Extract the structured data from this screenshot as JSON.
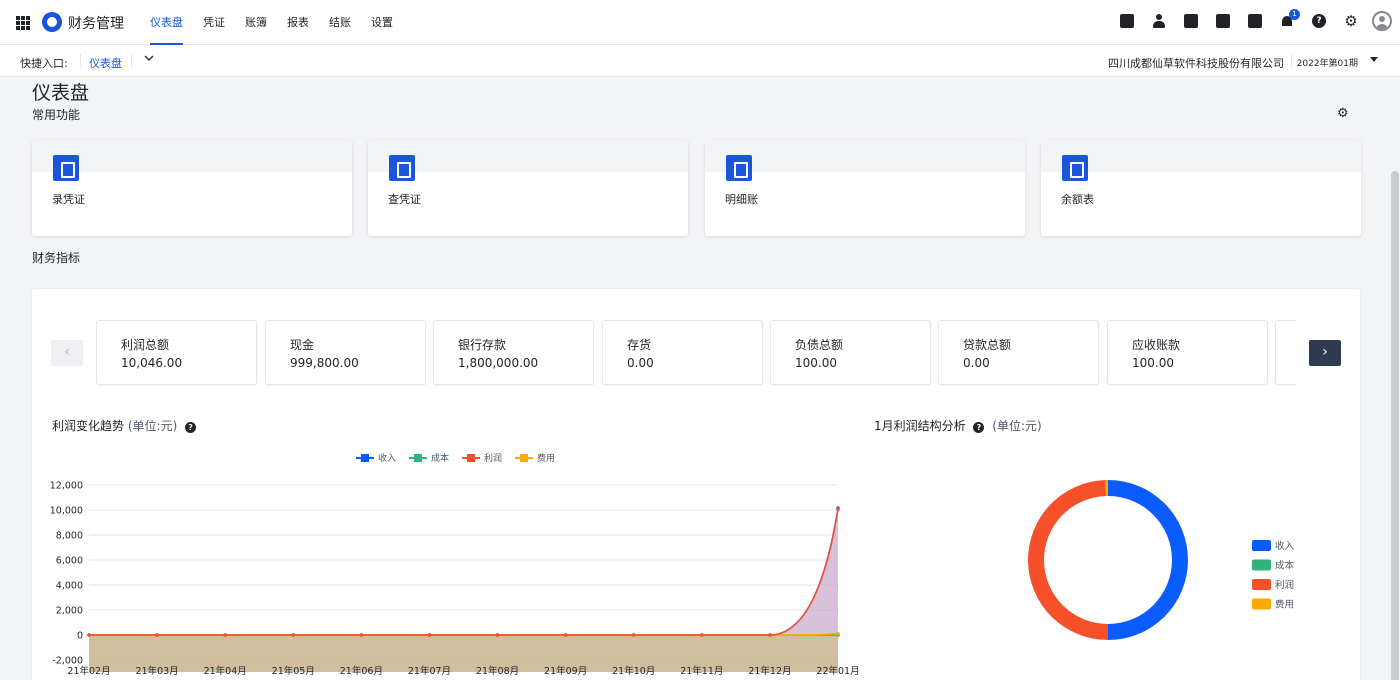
{
  "header": {
    "app_title": "财务管理",
    "nav": [
      "仪表盘",
      "凭证",
      "账簿",
      "报表",
      "结账",
      "设置"
    ],
    "active_nav": 0,
    "notification_count": "1"
  },
  "subbar": {
    "quick_label": "快捷入口:",
    "quick_link": "仪表盘",
    "company": "四川成都仙草软件科技股份有限公司",
    "period": "2022年第01期"
  },
  "page": {
    "title": "仪表盘",
    "common_functions_label": "常用功能",
    "metrics_label": "财务指标"
  },
  "functions": [
    {
      "label": "录凭证",
      "icon": "voucher-entry-icon"
    },
    {
      "label": "查凭证",
      "icon": "voucher-search-icon"
    },
    {
      "label": "明细账",
      "icon": "ledger-icon"
    },
    {
      "label": "余额表",
      "icon": "balance-list-icon"
    }
  ],
  "metrics": [
    {
      "label": "利润总额",
      "value": "10,046.00"
    },
    {
      "label": "现金",
      "value": "999,800.00"
    },
    {
      "label": "银行存款",
      "value": "1,800,000.00"
    },
    {
      "label": "存货",
      "value": "0.00"
    },
    {
      "label": "负债总额",
      "value": "100.00"
    },
    {
      "label": "贷款总额",
      "value": "0.00"
    },
    {
      "label": "应收账款",
      "value": "100.00"
    },
    {
      "label": "",
      "value": ""
    }
  ],
  "trend_chart": {
    "title": "利润变化趋势",
    "unit": "(单位:元)"
  },
  "pie_chart": {
    "title": "1月利润结构分析",
    "unit": "(单位:元)"
  },
  "colors": {
    "accent": "#1a56db",
    "income": "#0a5cff",
    "cost": "#33b27a",
    "profit": "#f5502a",
    "expense": "#ffaa00"
  },
  "chart_data": [
    {
      "type": "area",
      "categories": [
        "21年02月",
        "21年03月",
        "21年04月",
        "21年05月",
        "21年06月",
        "21年07月",
        "21年08月",
        "21年09月",
        "21年10月",
        "21年11月",
        "21年12月",
        "22年01月"
      ],
      "series": [
        {
          "name": "收入",
          "values": [
            0,
            0,
            0,
            0,
            0,
            0,
            0,
            0,
            0,
            0,
            0,
            10146
          ]
        },
        {
          "name": "成本",
          "values": [
            0,
            0,
            0,
            0,
            0,
            0,
            0,
            0,
            0,
            0,
            0,
            0
          ]
        },
        {
          "name": "利润",
          "values": [
            0,
            0,
            0,
            0,
            0,
            0,
            0,
            0,
            0,
            0,
            0,
            10046
          ]
        },
        {
          "name": "费用",
          "values": [
            0,
            0,
            0,
            0,
            0,
            0,
            0,
            0,
            0,
            0,
            0,
            100
          ]
        }
      ],
      "yticks": [
        "12,000",
        "10,000",
        "8,000",
        "6,000",
        "4,000",
        "2,000",
        "0",
        "-2,000"
      ],
      "ylim": [
        -2000,
        12000
      ],
      "grid": true,
      "legend_position": "top-center"
    },
    {
      "type": "pie",
      "labels": [
        "收入",
        "成本",
        "利润",
        "费用"
      ],
      "values": [
        10146,
        0,
        10046,
        100
      ],
      "donut": true,
      "legend_position": "right"
    }
  ]
}
